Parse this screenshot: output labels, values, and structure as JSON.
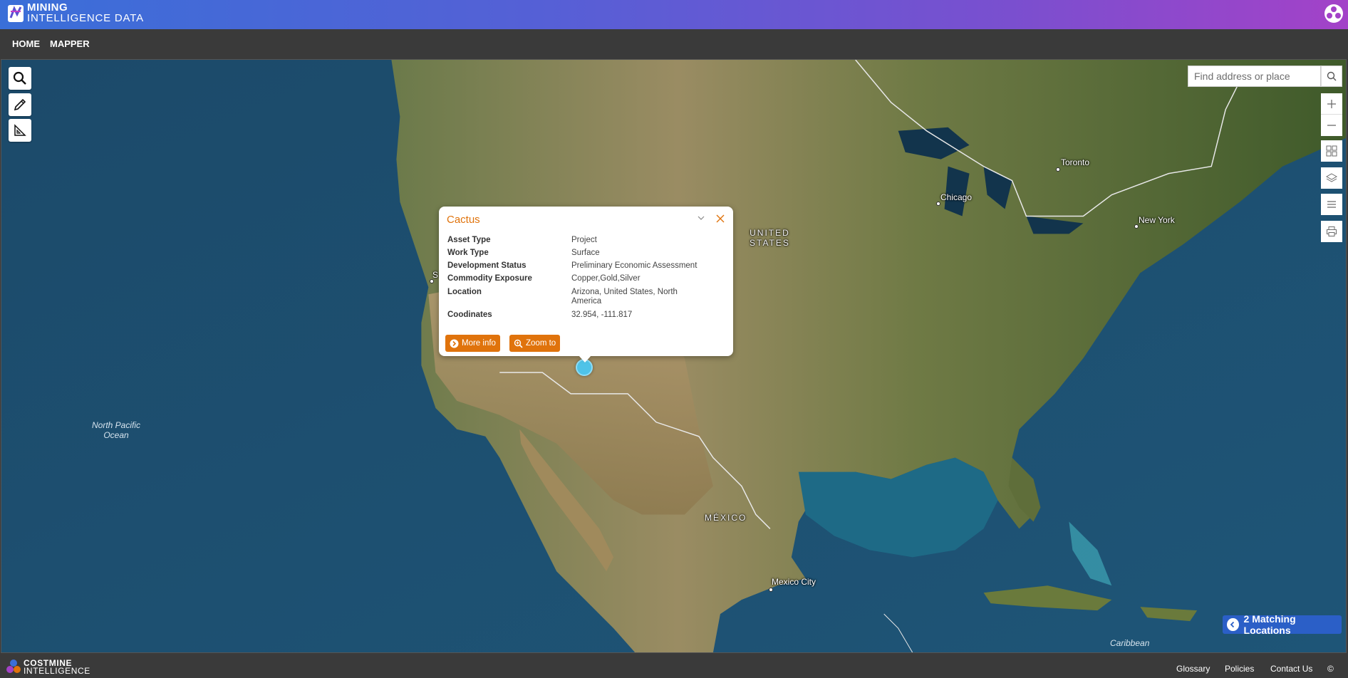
{
  "header": {
    "brand_line1": "MINING",
    "brand_line2": "INTELLIGENCE DATA",
    "brand_color": "#3a6fd8",
    "accent_color": "#a342c8"
  },
  "nav": {
    "items": [
      {
        "label": "HOME"
      },
      {
        "label": "MAPPER"
      }
    ]
  },
  "map": {
    "search_placeholder": "Find address or place",
    "labels": {
      "united_states": "UNITED\nSTATES",
      "mexico": "MÉXICO",
      "pacific": "North Pacific\nOcean",
      "caribbean": "Caribbean",
      "toronto": "Toronto",
      "chicago": "Chicago",
      "new_york": "New York",
      "mexico_city": "Mexico City",
      "sf_partial": "S"
    },
    "left_tools": [
      "search-icon",
      "pencil-icon",
      "ruler-icon"
    ],
    "right_widgets": [
      "zoom-in-icon",
      "zoom-out-icon",
      "basemap-gallery-icon",
      "layers-icon",
      "legend-list-icon",
      "print-icon"
    ]
  },
  "popup": {
    "title": "Cactus",
    "rows": [
      {
        "key": "Asset Type",
        "value": "Project"
      },
      {
        "key": "Work Type",
        "value": "Surface"
      },
      {
        "key": "Development Status",
        "value": "Preliminary Economic Assessment"
      },
      {
        "key": "Commodity Exposure",
        "value": "Copper,Gold,Silver"
      },
      {
        "key": "Location",
        "value": "Arizona, United States, North America"
      },
      {
        "key": "Coodinates",
        "value": "32.954, -111.817"
      }
    ],
    "more_info_label": "More info",
    "zoom_to_label": "Zoom to",
    "accent_color": "#e0730c"
  },
  "matching": {
    "label": "2 Matching Locations"
  },
  "footer": {
    "brand_line1": "COSTMINE",
    "brand_line2": "INTELLIGENCE",
    "links": [
      {
        "label": "Glossary"
      },
      {
        "label": "Policies"
      },
      {
        "label": "Contact Us"
      },
      {
        "label": "©"
      }
    ]
  }
}
